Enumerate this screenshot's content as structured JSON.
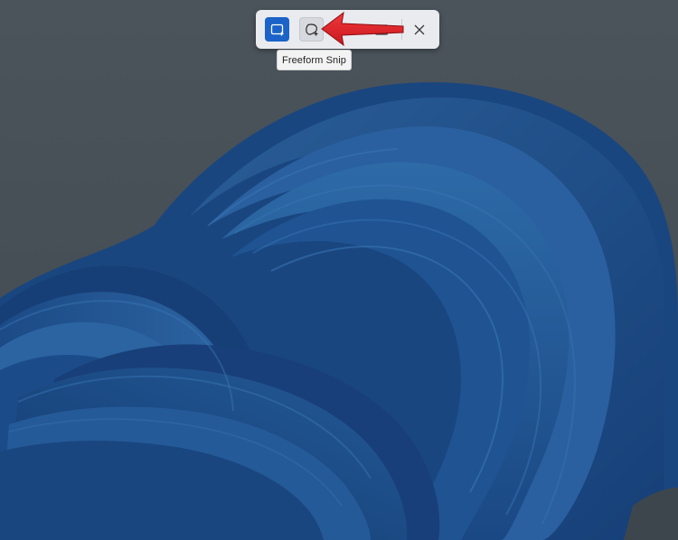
{
  "snip_toolbar": {
    "buttons": [
      {
        "name": "rectangular-snip",
        "icon": "rectangle-snip-icon",
        "selected": true
      },
      {
        "name": "freeform-snip",
        "icon": "freeform-snip-icon",
        "hovered": true
      },
      {
        "name": "window-snip",
        "icon": "window-snip-icon"
      },
      {
        "name": "close",
        "icon": "close-icon"
      }
    ]
  },
  "tooltip": {
    "text": "Freeform Snip"
  },
  "annotation": {
    "arrow_color": "#e3262b"
  },
  "colors": {
    "selected_button": "#1b63c8",
    "toolbar_bg": "#e9ebef",
    "wallpaper_bg": "#4a5359",
    "bloom_blue": "#1e4f8f"
  }
}
